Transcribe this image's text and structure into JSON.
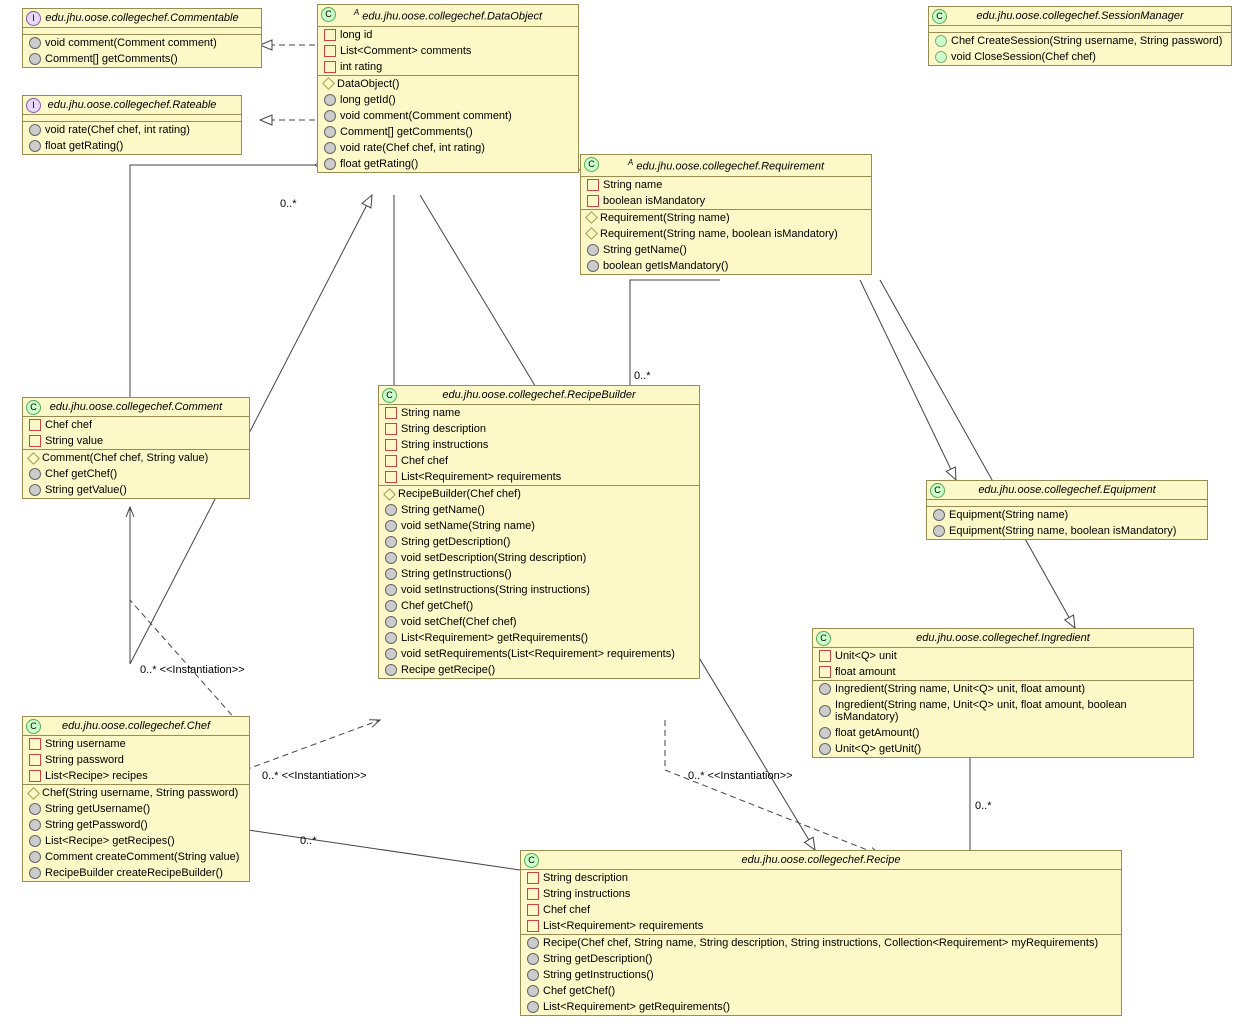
{
  "commentable": {
    "title": "edu.jhu.oose.collegechef.Commentable",
    "m": [
      "void comment(Comment comment)",
      "Comment[] getComments()"
    ]
  },
  "rateable": {
    "title": "edu.jhu.oose.collegechef.Rateable",
    "m": [
      "void rate(Chef chef, int rating)",
      "float getRating()"
    ]
  },
  "dataobject": {
    "title": "edu.jhu.oose.collegechef.DataObject",
    "a": [
      "long id",
      "List<Comment> comments",
      "int rating"
    ],
    "m": [
      "DataObject()",
      "long getId()",
      "void comment(Comment comment)",
      "Comment[] getComments()",
      "void rate(Chef chef, int rating)",
      "float getRating()"
    ]
  },
  "sessionmanager": {
    "title": "edu.jhu.oose.collegechef.SessionManager",
    "m": [
      "Chef CreateSession(String username, String password)",
      "void CloseSession(Chef chef)"
    ]
  },
  "requirement": {
    "title": "edu.jhu.oose.collegechef.Requirement",
    "a": [
      "String name",
      "boolean isMandatory"
    ],
    "m": [
      "Requirement(String name)",
      "Requirement(String name, boolean isMandatory)",
      "String getName()",
      "boolean getIsMandatory()"
    ]
  },
  "comment": {
    "title": "edu.jhu.oose.collegechef.Comment",
    "a": [
      "Chef chef",
      "String value"
    ],
    "m": [
      "Comment(Chef chef, String value)",
      "Chef getChef()",
      "String getValue()"
    ]
  },
  "recipebuilder": {
    "title": "edu.jhu.oose.collegechef.RecipeBuilder",
    "a": [
      "String name",
      "String description",
      "String instructions",
      "Chef chef",
      "List<Requirement> requirements"
    ],
    "m": [
      "RecipeBuilder(Chef chef)",
      "String getName()",
      "void setName(String name)",
      "String getDescription()",
      "void setDescription(String description)",
      "String getInstructions()",
      "void setInstructions(String instructions)",
      "Chef getChef()",
      "void setChef(Chef chef)",
      "List<Requirement> getRequirements()",
      "void setRequirements(List<Requirement> requirements)",
      "Recipe getRecipe()"
    ]
  },
  "equipment": {
    "title": "edu.jhu.oose.collegechef.Equipment",
    "m": [
      "Equipment(String name)",
      "Equipment(String name, boolean isMandatory)"
    ]
  },
  "ingredient": {
    "title": "edu.jhu.oose.collegechef.Ingredient",
    "a": [
      "Unit<Q> unit",
      "float amount"
    ],
    "m": [
      "Ingredient(String name, Unit<Q> unit, float amount)",
      "Ingredient(String name, Unit<Q> unit, float amount, boolean isMandatory)",
      "float getAmount()",
      "Unit<Q> getUnit()"
    ]
  },
  "chef": {
    "title": "edu.jhu.oose.collegechef.Chef",
    "a": [
      "String username",
      "String password",
      "List<Recipe> recipes"
    ],
    "m": [
      "Chef(String username, String password)",
      "String getUsername()",
      "String getPassword()",
      "List<Recipe> getRecipes()",
      "Comment createComment(String value)",
      "RecipeBuilder createRecipeBuilder()"
    ]
  },
  "recipe": {
    "title": "edu.jhu.oose.collegechef.Recipe",
    "a": [
      "String description",
      "String instructions",
      "Chef chef",
      "List<Requirement> requirements"
    ],
    "m": [
      "Recipe(Chef chef, String name, String description, String instructions, Collection<Requirement> myRequirements)",
      "String getDescription()",
      "String getInstructions()",
      "Chef getChef()",
      "List<Requirement> getRequirements()"
    ]
  },
  "labels": {
    "l1": "0..*",
    "l2": "0..*  <<Instantiation>>",
    "l3": "0..*  <<Instantiation>>",
    "l4": "0..*  <<Instantiation>>",
    "l5": "0..*",
    "l6": "0..*",
    "l7": "0..*"
  }
}
